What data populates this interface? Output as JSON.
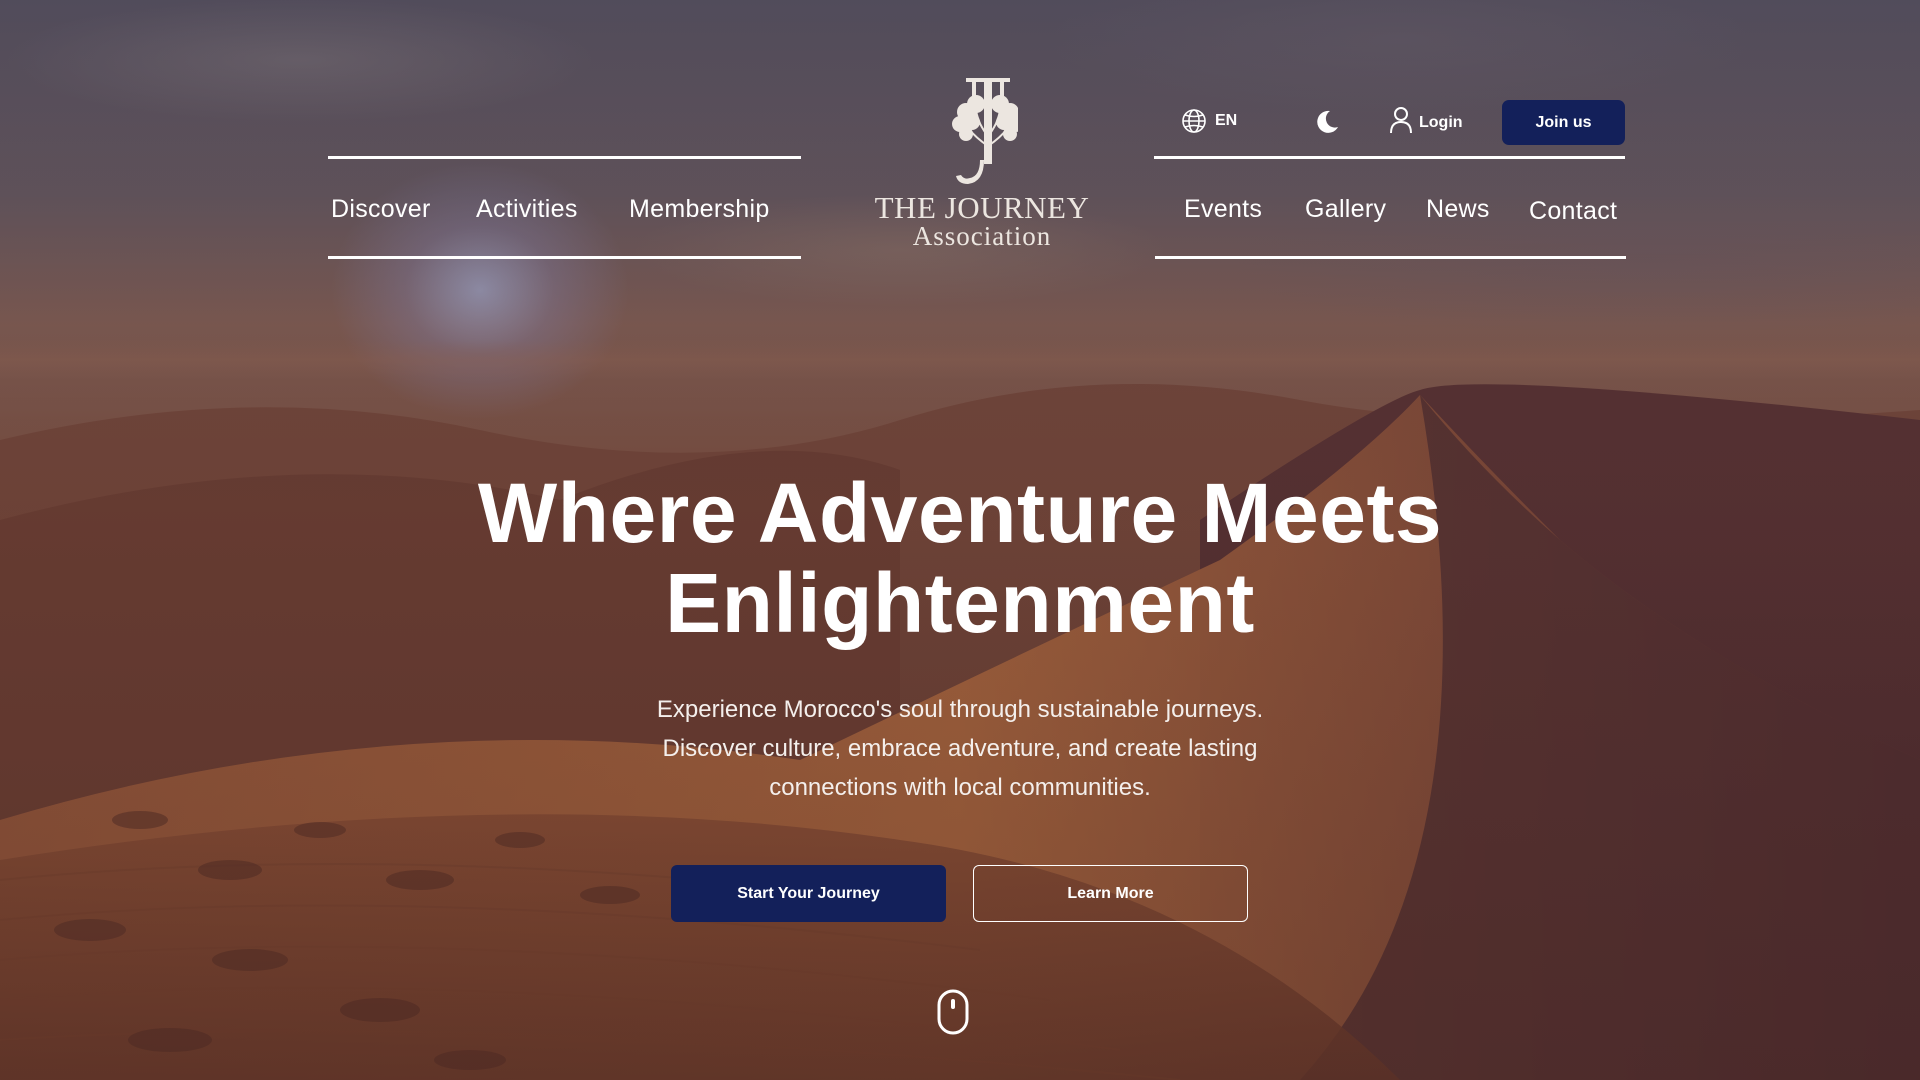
{
  "brand": {
    "logo_letter": "J",
    "title": "THE JOURNEY",
    "subtitle": "Association"
  },
  "nav_left": [
    {
      "label": "Discover"
    },
    {
      "label": "Activities"
    },
    {
      "label": "Membership"
    }
  ],
  "nav_right": [
    {
      "label": "Events"
    },
    {
      "label": "Gallery"
    },
    {
      "label": "News"
    },
    {
      "label": "Contact"
    }
  ],
  "utility": {
    "language": "EN",
    "language_icon": "globe-icon",
    "theme_icon": "moon-icon",
    "login_label": "Login",
    "login_icon": "user-icon",
    "join_label": "Join us"
  },
  "hero": {
    "headline_line1": "Where Adventure Meets",
    "headline_line2": "Enlightenment",
    "sub_line1": "Experience Morocco's soul through sustainable journeys.",
    "sub_line2": "Discover culture, embrace adventure, and create lasting",
    "sub_line3": "connections with local communities.",
    "primary_cta": "Start Your Journey",
    "secondary_cta": "Learn More",
    "scroll_icon": "mouse-scroll-icon"
  },
  "colors": {
    "primary_button": "#13205a",
    "text": "#ffffff"
  }
}
